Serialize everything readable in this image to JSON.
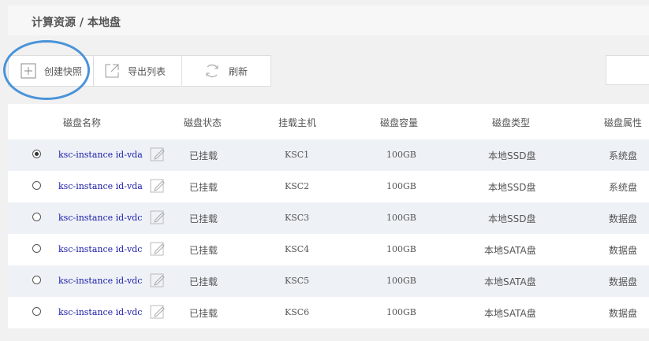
{
  "breadcrumb": "计算资源 / 本地盘",
  "toolbar": {
    "create_label": "创建快照",
    "export_label": "导出列表",
    "refresh_label": "刷新"
  },
  "table": {
    "columns": [
      "磁盘名称",
      "磁盘状态",
      "挂载主机",
      "磁盘容量",
      "磁盘类型",
      "磁盘属性"
    ],
    "rows": [
      {
        "name": "ksc-instance id-vda",
        "status": "已挂载",
        "host": "KSC1",
        "capacity": "100GB",
        "type": "本地SSD盘",
        "attr": "系统盘",
        "selected": true
      },
      {
        "name": "ksc-instance id-vda",
        "status": "已挂载",
        "host": "KSC2",
        "capacity": "100GB",
        "type": "本地SSD盘",
        "attr": "系统盘",
        "selected": false
      },
      {
        "name": "ksc-instance id-vdc",
        "status": "已挂载",
        "host": "KSC3",
        "capacity": "100GB",
        "type": "本地SSD盘",
        "attr": "数据盘",
        "selected": false
      },
      {
        "name": "ksc-instance id-vdc",
        "status": "已挂载",
        "host": "KSC4",
        "capacity": "100GB",
        "type": "本地SATA盘",
        "attr": "数据盘",
        "selected": false
      },
      {
        "name": "ksc-instance id-vdc",
        "status": "已挂载",
        "host": "KSC5",
        "capacity": "100GB",
        "type": "本地SATA盘",
        "attr": "数据盘",
        "selected": false
      },
      {
        "name": "ksc-instance id-vdc",
        "status": "已挂载",
        "host": "KSC6",
        "capacity": "100GB",
        "type": "本地SATA盘",
        "attr": "数据盘",
        "selected": false
      }
    ]
  },
  "colors": {
    "highlight_circle": "#4a93d9",
    "link": "#1a1aaa",
    "row_alt": "#eef2f6"
  }
}
